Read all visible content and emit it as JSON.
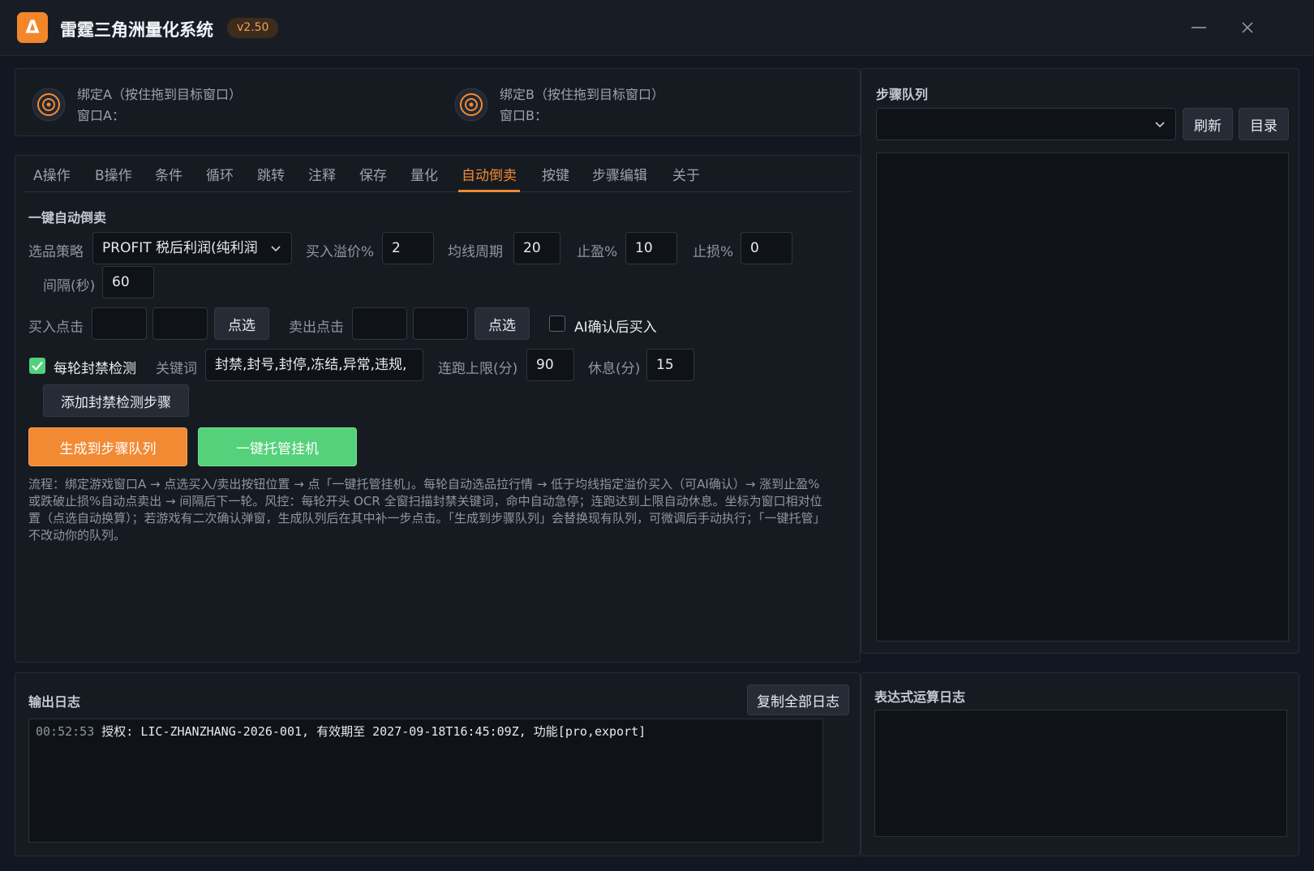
{
  "titlebar": {
    "app_name": "雷霆三角洲量化系统",
    "version": "v2.50",
    "logo_glyph": "Δ"
  },
  "colors": {
    "accent": "#f28a33",
    "success": "#54d17a",
    "background": "#121821"
  },
  "bind": {
    "a": {
      "label": "绑定A（按住拖到目标窗口）",
      "window": "窗口A："
    },
    "b": {
      "label": "绑定B（按住拖到目标窗口）",
      "window": "窗口B："
    }
  },
  "tabs": [
    {
      "label": "A操作"
    },
    {
      "label": "B操作"
    },
    {
      "label": "条件"
    },
    {
      "label": "循环"
    },
    {
      "label": "跳转"
    },
    {
      "label": "注释"
    },
    {
      "label": "保存"
    },
    {
      "label": "量化"
    },
    {
      "label": "自动倒卖",
      "active": true
    },
    {
      "label": "按键"
    },
    {
      "label": "步骤编辑"
    },
    {
      "label": "关于"
    }
  ],
  "auto_trade": {
    "section_title": "一键自动倒卖",
    "strategy_label": "选品策略",
    "strategy_value": "PROFIT 税后利润(纯利润",
    "premium_label": "买入溢价%",
    "premium_value": "2",
    "ma_label": "均线周期",
    "ma_value": "20",
    "tp_label": "止盈%",
    "tp_value": "10",
    "sl_label": "止损%",
    "sl_value": "0",
    "interval_label": "间隔(秒)",
    "interval_value": "60",
    "buy_click_label": "买入点击",
    "buy_pick_button": "点选",
    "sell_click_label": "卖出点击",
    "sell_pick_button": "点选",
    "ai_confirm_label": "AI确认后买入",
    "ai_confirm_checked": false,
    "ban_check_label": "每轮封禁检测",
    "ban_check_checked": true,
    "keyword_label": "关键词",
    "keyword_value": "封禁,封号,封停,冻结,异常,违规,",
    "run_limit_label": "连跑上限(分)",
    "run_limit_value": "90",
    "rest_label": "休息(分)",
    "rest_value": "15",
    "add_ban_step_button": "添加封禁检测步骤",
    "generate_button": "生成到步骤队列",
    "hosting_button": "一键托管挂机",
    "flow_text": "流程：绑定游戏窗口A → 点选买入/卖出按钮位置 → 点「一键托管挂机」。每轮自动选品拉行情 → 低于均线指定溢价买入（可AI确认）→ 涨到止盈%或跌破止损%自动点卖出 → 间隔后下一轮。风控：每轮开头 OCR 全窗扫描封禁关键词，命中自动急停；连跑达到上限自动休息。坐标为窗口相对位置（点选自动换算）；若游戏有二次确认弹窗，生成队列后在其中补一步点击。「生成到步骤队列」会替换现有队列，可微调后手动执行；「一键托管」不改动你的队列。"
  },
  "step_queue": {
    "title": "步骤队列",
    "refresh_button": "刷新",
    "directory_button": "目录"
  },
  "log": {
    "title": "输出日志",
    "copy_button": "复制全部日志",
    "entries": [
      {
        "time": "00:52:53",
        "text": "授权: LIC-ZHANZHANG-2026-001, 有效期至 2027-09-18T16:45:09Z, 功能[pro,export]"
      }
    ]
  },
  "expr_log": {
    "title": "表达式运算日志"
  }
}
